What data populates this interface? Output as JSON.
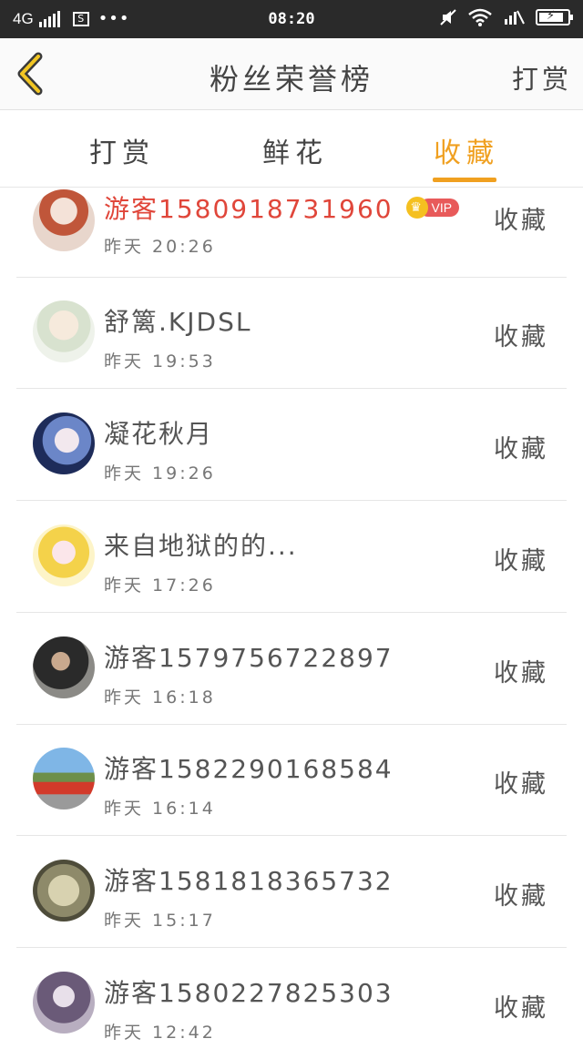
{
  "status_bar": {
    "carrier": "4G",
    "sim_label": "S",
    "time": "08:20",
    "signal2": "I/",
    "battery_icon": "battery-charging-icon"
  },
  "header": {
    "title": "粉丝荣誉榜",
    "right_action": "打赏"
  },
  "tabs": [
    {
      "label": "打赏",
      "active": false
    },
    {
      "label": "鲜花",
      "active": false
    },
    {
      "label": "收藏",
      "active": true
    }
  ],
  "accent_color": "#f0a020",
  "vip_color": "#e0463a",
  "fans": [
    {
      "name": "游客1580918731960",
      "time": "昨天  20:26",
      "action": "收藏",
      "vip": true,
      "vip_label": "VIP"
    },
    {
      "name": "舒篱.KJDSL",
      "time": "昨天  19:53",
      "action": "收藏"
    },
    {
      "name": "凝花秋月",
      "time": "昨天  19:26",
      "action": "收藏"
    },
    {
      "name": "来自地狱的的...",
      "time": "昨天  17:26",
      "action": "收藏"
    },
    {
      "name": "游客1579756722897",
      "time": "昨天  16:18",
      "action": "收藏"
    },
    {
      "name": "游客1582290168584",
      "time": "昨天  16:14",
      "action": "收藏"
    },
    {
      "name": "游客1581818365732",
      "time": "昨天  15:17",
      "action": "收藏"
    },
    {
      "name": "游客1580227825303",
      "time": "昨天  12:42",
      "action": "收藏"
    }
  ]
}
